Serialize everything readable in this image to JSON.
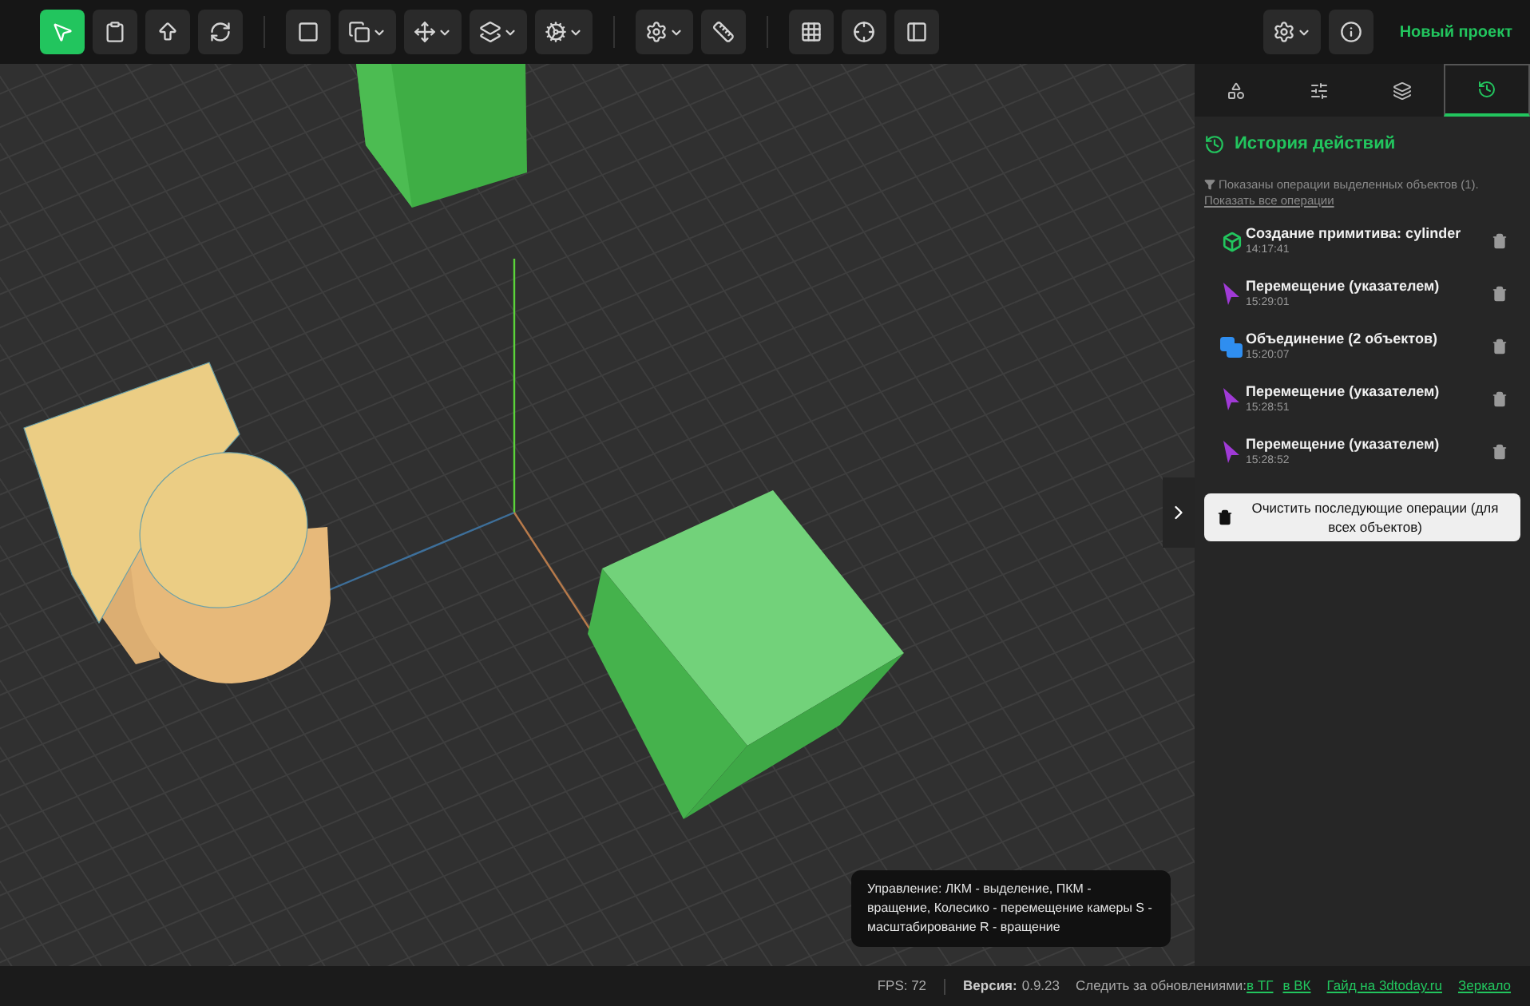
{
  "toolbar": {
    "groups": [
      [
        {
          "selected": true,
          "dropdown": false
        },
        {
          "selected": false,
          "dropdown": false
        },
        {
          "selected": false,
          "dropdown": false
        },
        {
          "selected": false,
          "dropdown": false
        }
      ],
      [
        {
          "selected": false,
          "dropdown": false
        },
        {
          "selected": false,
          "dropdown": true
        },
        {
          "selected": false,
          "dropdown": true
        },
        {
          "selected": false,
          "dropdown": true
        },
        {
          "selected": false,
          "dropdown": true
        }
      ],
      [
        {
          "selected": false,
          "dropdown": true
        },
        {
          "selected": false,
          "dropdown": false
        }
      ],
      [
        {
          "selected": false,
          "dropdown": false
        },
        {
          "selected": false,
          "dropdown": false
        },
        {
          "selected": false,
          "dropdown": false
        }
      ]
    ],
    "right_buttons": [
      {
        "selected": false,
        "dropdown": true
      },
      {
        "selected": false,
        "dropdown": false
      }
    ],
    "project_title": "Новый проект"
  },
  "viewport": {
    "hint": "Управление: ЛКМ - выделение, ПКМ - вращение, Колесико - перемещение камеры S - масштабирование R - вращение"
  },
  "sidebar": {
    "tabs": [
      {
        "selected": false
      },
      {
        "selected": false
      },
      {
        "selected": false
      },
      {
        "selected": true
      }
    ],
    "title": "История действий",
    "filter_note": "Показаны операции выделенных объектов (1).",
    "show_all_link": "Показать все операции",
    "history": [
      {
        "kind": "primitive",
        "title": "Создание примитива: cylinder",
        "time": "14:17:41"
      },
      {
        "kind": "move",
        "title": "Перемещение (указателем)",
        "time": "15:29:01"
      },
      {
        "kind": "union",
        "title": "Объединение (2 объектов)",
        "time": "15:20:07"
      },
      {
        "kind": "move",
        "title": "Перемещение (указателем)",
        "time": "15:28:51"
      },
      {
        "kind": "move",
        "title": "Перемещение (указателем)",
        "time": "15:28:52"
      }
    ],
    "clear_button": "Очистить последующие операции (для всех объектов)"
  },
  "status_bar": {
    "fps": "FPS: 72",
    "version_label": "Версия:",
    "version": "0.9.23",
    "follow_label": "Следить за обновлениями:",
    "links": [
      "в ТГ",
      "в ВК",
      "Гайд на 3dtoday.ru",
      "Зеркало"
    ]
  }
}
